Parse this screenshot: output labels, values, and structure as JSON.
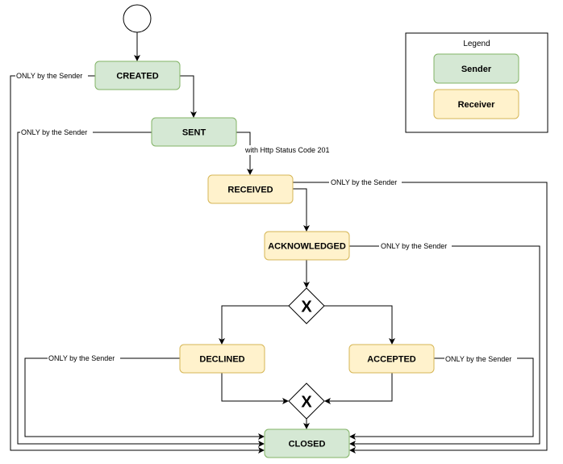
{
  "diagram": {
    "start": {
      "name": "start-node"
    },
    "states": {
      "created": {
        "label": "CREATED",
        "role": "sender"
      },
      "sent": {
        "label": "SENT",
        "role": "sender"
      },
      "received": {
        "label": "RECEIVED",
        "role": "receiver"
      },
      "acknowledged": {
        "label": "ACKNOWLEDGED",
        "role": "receiver"
      },
      "declined": {
        "label": "DECLINED",
        "role": "receiver"
      },
      "accepted": {
        "label": "ACCEPTED",
        "role": "receiver"
      },
      "closed": {
        "label": "CLOSED",
        "role": "sender"
      }
    },
    "gateways": {
      "split": {
        "symbol": "X"
      },
      "merge": {
        "symbol": "X"
      }
    },
    "edge_labels": {
      "sent_to_received": "with Http Status Code 201",
      "created_to_closed": "ONLY by the Sender",
      "sent_to_closed": "ONLY by the Sender",
      "received_to_closed": "ONLY by the Sender",
      "acknowledged_to_closed": "ONLY by the Sender",
      "declined_to_closed": "ONLY by the Sender",
      "accepted_to_closed": "ONLY by the Sender"
    },
    "legend": {
      "title": "Legend",
      "items": [
        {
          "label": "Sender",
          "color": "#d5e8d4",
          "border": "#82b366"
        },
        {
          "label": "Receiver",
          "color": "#fff2cc",
          "border": "#d6b656"
        }
      ]
    }
  }
}
